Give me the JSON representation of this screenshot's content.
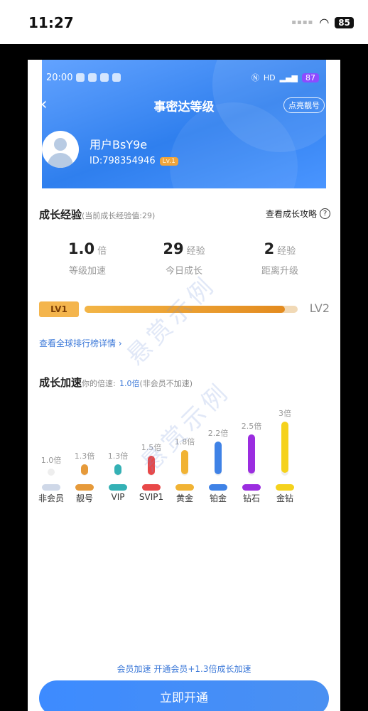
{
  "outer_status": {
    "time": "11:27",
    "dots": "▪▪▪▪",
    "battery": "85"
  },
  "inner_status": {
    "time": "20:00",
    "battery": "87",
    "network": "HD"
  },
  "header": {
    "title": "事密达等级",
    "back": "‹",
    "badge_button": "点亮靓号"
  },
  "user": {
    "name": "用户BsY9e",
    "id": "ID:798354946",
    "level_tag": "Lv.1"
  },
  "growth": {
    "title": "成长经验",
    "current_note": "(当前成长经验值:29)",
    "guide_link": "查看成长攻略",
    "stats": [
      {
        "value": "1.0",
        "unit": "倍",
        "label": "等级加速"
      },
      {
        "value": "29",
        "unit": "经验",
        "label": "今日成长"
      },
      {
        "value": "2",
        "unit": "经验",
        "label": "距离升级"
      }
    ],
    "level_from": "LV1",
    "level_to": "LV2",
    "progress_fraction": 0.94
  },
  "rank_link": "查看全球排行榜详情",
  "speed": {
    "title": "成长加速",
    "prefix": "你的倍速:",
    "value": "1.0倍",
    "suffix": "(非会员不加速)",
    "tiers": [
      {
        "mult": "1.0倍",
        "name": "非会员",
        "level": 0.0,
        "color": "#cfd8e8"
      },
      {
        "mult": "1.3倍",
        "name": "靓号",
        "level": 0.2,
        "color": "#e69a3a"
      },
      {
        "mult": "1.3倍",
        "name": "VIP",
        "level": 0.2,
        "color": "#34b1b5"
      },
      {
        "mult": "1.5倍",
        "name": "SVIP1",
        "level": 0.35,
        "color": "#e84848"
      },
      {
        "mult": "1.8倍",
        "name": "黄金",
        "level": 0.45,
        "color": "#f1b334"
      },
      {
        "mult": "2.2倍",
        "name": "铂金",
        "level": 0.6,
        "color": "#3f82e6"
      },
      {
        "mult": "2.5倍",
        "name": "钻石",
        "level": 0.72,
        "color": "#9b2de0"
      },
      {
        "mult": "3倍",
        "name": "金钻",
        "level": 0.95,
        "color": "#f5d21c"
      }
    ]
  },
  "watermark": "悬赏示例",
  "promo_text": "会员加速 开通会员+1.3倍成长加速",
  "cta_label": "立即开通"
}
